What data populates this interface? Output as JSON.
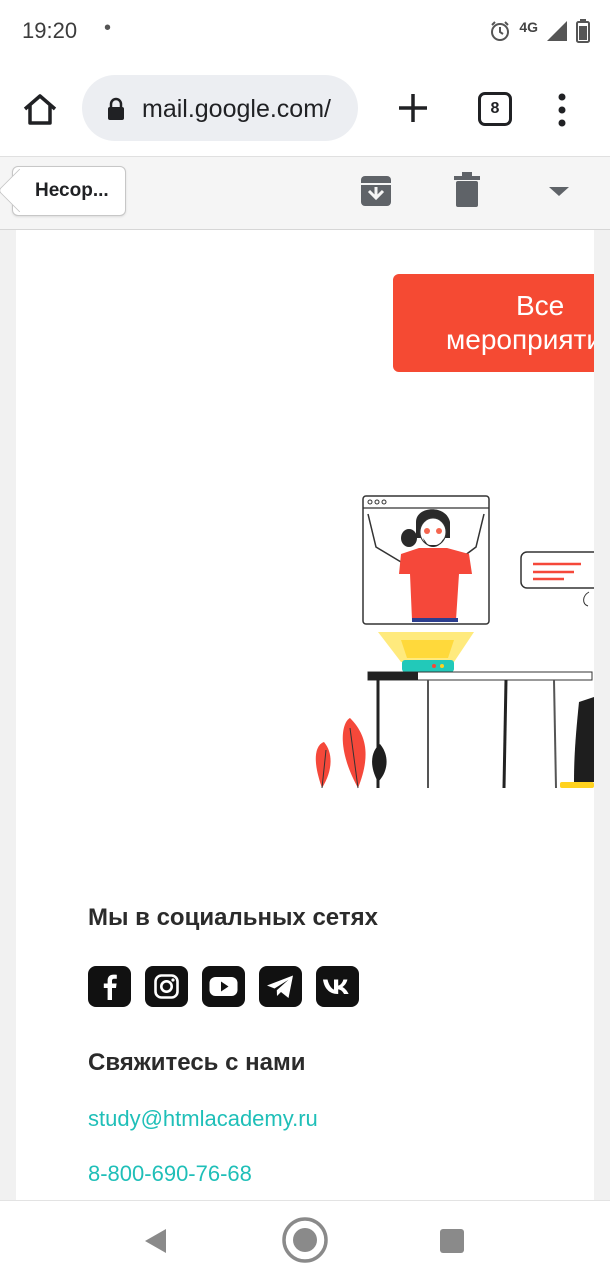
{
  "status_bar": {
    "time": "19:20",
    "dot": "•",
    "network": "4G"
  },
  "browser": {
    "url": "mail.google.com/",
    "tab_count": "8"
  },
  "gmail_toolbar": {
    "back_label": "Несор..."
  },
  "email": {
    "events_button": {
      "line1": "Все",
      "line2": "мероприятия"
    },
    "social": {
      "title": "Мы в социальных сетях",
      "icons": [
        "facebook-icon",
        "instagram-icon",
        "youtube-icon",
        "telegram-icon",
        "vk-icon"
      ]
    },
    "contact": {
      "title": "Свяжитесь с нами",
      "email": "study@htmlacademy.ru",
      "phone": "8-800-690-76-68"
    }
  },
  "colors": {
    "accent": "#f54a33",
    "link": "#1fbfb8"
  }
}
